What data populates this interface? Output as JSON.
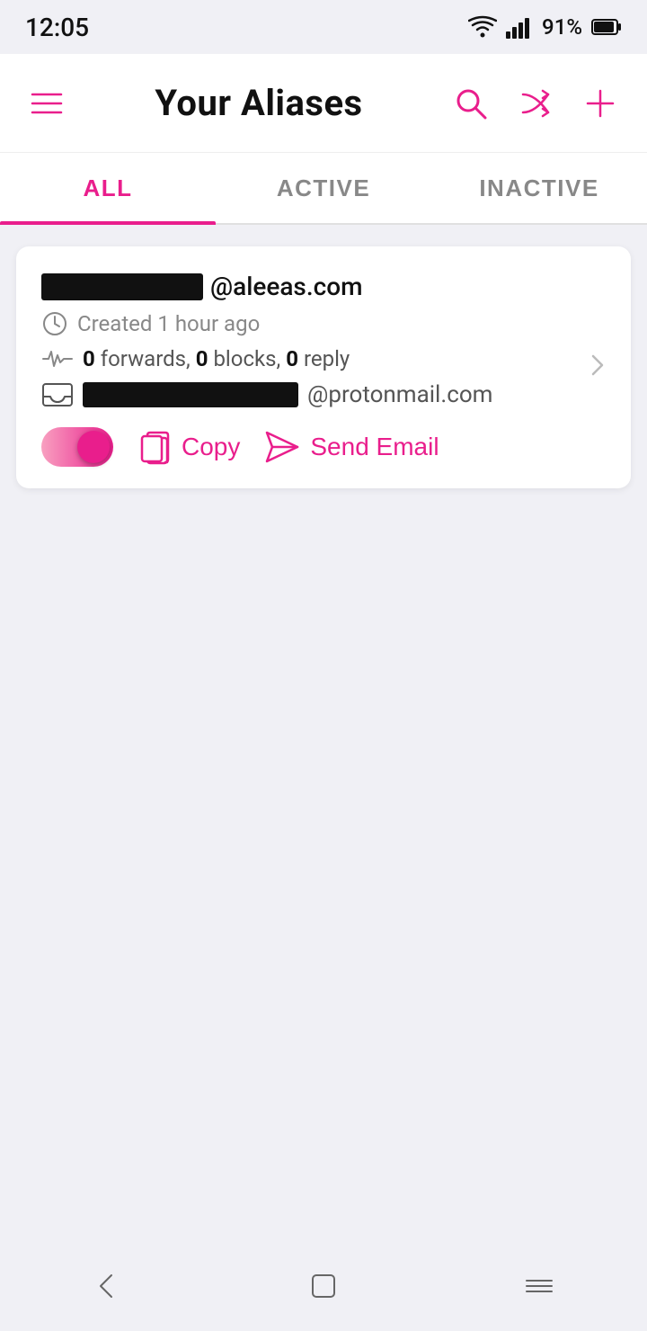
{
  "statusBar": {
    "time": "12:05",
    "battery": "91%",
    "batteryIcon": "battery-icon",
    "wifiIcon": "wifi-icon",
    "signalIcon": "signal-icon"
  },
  "appBar": {
    "menuIcon": "hamburger-icon",
    "title": "Your Aliases",
    "searchIcon": "search-icon",
    "shuffleIcon": "shuffle-icon",
    "addIcon": "add-icon"
  },
  "tabs": [
    {
      "label": "ALL",
      "active": true
    },
    {
      "label": "ACTIVE",
      "active": false
    },
    {
      "label": "INACTIVE",
      "active": false
    }
  ],
  "aliases": [
    {
      "emailDomain": "@aleeas.com",
      "createdText": "Created 1 hour ago",
      "stats": "0 forwards, 0 blocks, 0 reply",
      "recipientDomain": "@protonmail.com",
      "toggleActive": true,
      "copyLabel": "Copy",
      "sendEmailLabel": "Send Email"
    }
  ],
  "navBar": {
    "backIcon": "back-icon",
    "homeIcon": "home-icon",
    "recentIcon": "recent-apps-icon"
  }
}
